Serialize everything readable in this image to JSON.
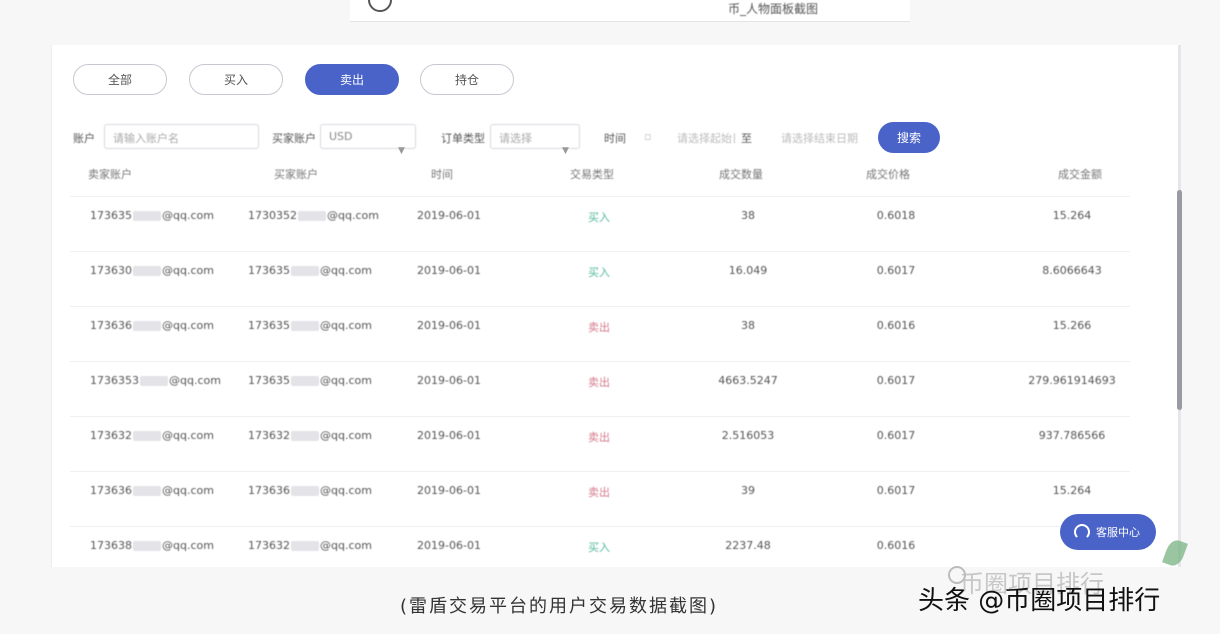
{
  "top_bar": {
    "text": "币_人物面板截图"
  },
  "tabs": [
    {
      "label": "全部"
    },
    {
      "label": "买入"
    },
    {
      "label": "卖出"
    },
    {
      "label": "持仓"
    }
  ],
  "filters": {
    "account_label": "账户",
    "account_placeholder": "请输入账户名",
    "buy_label": "买家账户",
    "buy_value": "USD",
    "type_label": "订单类型",
    "type_value": "请选择",
    "time_label": "时间",
    "time_start": "请选择起始日期",
    "time_sep": "至",
    "time_end": "请选择结束日期",
    "query_button": "搜索"
  },
  "table": {
    "headers": [
      "卖家账户",
      "买家账户",
      "时间",
      "交易类型",
      "成交数量",
      "成交价格",
      "成交金额"
    ],
    "rows": [
      {
        "seller_pre": "173635",
        "seller_post": "@qq.com",
        "buyer_pre": "1730352",
        "buyer_post": "@qq.com",
        "date": "2019-06-01",
        "type": "买入",
        "kind": "buy",
        "qty": "38",
        "price": "0.6018",
        "amount": "15.264"
      },
      {
        "seller_pre": "173630",
        "seller_post": "@qq.com",
        "buyer_pre": "173635",
        "buyer_post": "@qq.com",
        "date": "2019-06-01",
        "type": "买入",
        "kind": "buy",
        "qty": "16.049",
        "price": "0.6017",
        "amount": "8.6066643"
      },
      {
        "seller_pre": "173636",
        "seller_post": "@qq.com",
        "buyer_pre": "173635",
        "buyer_post": "@qq.com",
        "date": "2019-06-01",
        "type": "卖出",
        "kind": "sell",
        "qty": "38",
        "price": "0.6016",
        "amount": "15.266"
      },
      {
        "seller_pre": "1736353",
        "seller_post": "@qq.com",
        "buyer_pre": "173635",
        "buyer_post": "@qq.com",
        "date": "2019-06-01",
        "type": "卖出",
        "kind": "sell",
        "qty": "4663.5247",
        "price": "0.6017",
        "amount": "279.961914693"
      },
      {
        "seller_pre": "173632",
        "seller_post": "@qq.com",
        "buyer_pre": "173632",
        "buyer_post": "@qq.com",
        "date": "2019-06-01",
        "type": "卖出",
        "kind": "sell",
        "qty": "2.516053",
        "price": "0.6017",
        "amount": "937.786566"
      },
      {
        "seller_pre": "173636",
        "seller_post": "@qq.com",
        "buyer_pre": "173636",
        "buyer_post": "@qq.com",
        "date": "2019-06-01",
        "type": "卖出",
        "kind": "sell",
        "qty": "39",
        "price": "0.6017",
        "amount": "15.264"
      },
      {
        "seller_pre": "173638",
        "seller_post": "@qq.com",
        "buyer_pre": "173632",
        "buyer_post": "@qq.com",
        "date": "2019-06-01",
        "type": "买入",
        "kind": "buy",
        "qty": "2237.48",
        "price": "0.6016",
        "amount": ""
      }
    ]
  },
  "service_button": {
    "label": "客服中心"
  },
  "caption": "(雷盾交易平台的用户交易数据截图)",
  "watermark_faint": "币圈项目排行",
  "watermark": "头条 @币圈项目排行"
}
